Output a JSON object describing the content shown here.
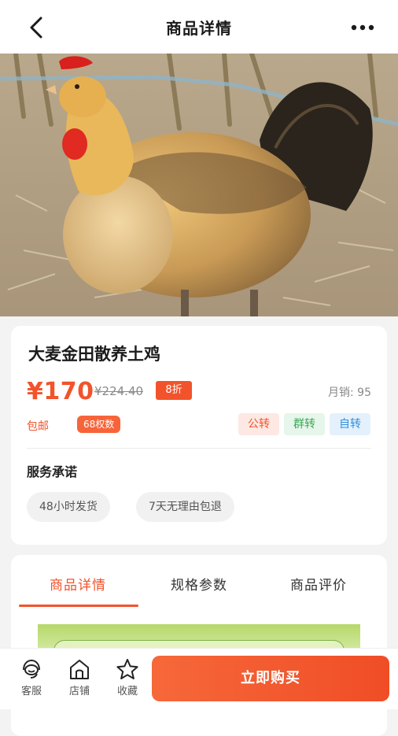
{
  "header": {
    "title": "商品详情",
    "back_icon": "chevron-left-icon",
    "more_icon": "more-horizontal-icon"
  },
  "product": {
    "image_alt": "free-range rooster photo",
    "name": "大麦金田散养土鸡",
    "price": "¥170",
    "original_price": "¥224.40",
    "discount": "8折",
    "monthly_sales": "月销: 95",
    "shipping": "包邮",
    "rights_badge": "68权数",
    "tags": [
      "公转",
      "群转",
      "自转"
    ]
  },
  "service": {
    "title": "服务承诺",
    "items": [
      "48小时发货",
      "7天无理由包退"
    ]
  },
  "tabs": [
    {
      "label": "商品详情",
      "active": true
    },
    {
      "label": "规格参数",
      "active": false
    },
    {
      "label": "商品评价",
      "active": false
    }
  ],
  "bottom": {
    "service_label": "客服",
    "shop_label": "店铺",
    "favorite_label": "收藏",
    "buy_label": "立即购买"
  },
  "colors": {
    "accent": "#f2532b",
    "green_tag": "#3aa757",
    "blue_tag": "#2f8fe0"
  }
}
